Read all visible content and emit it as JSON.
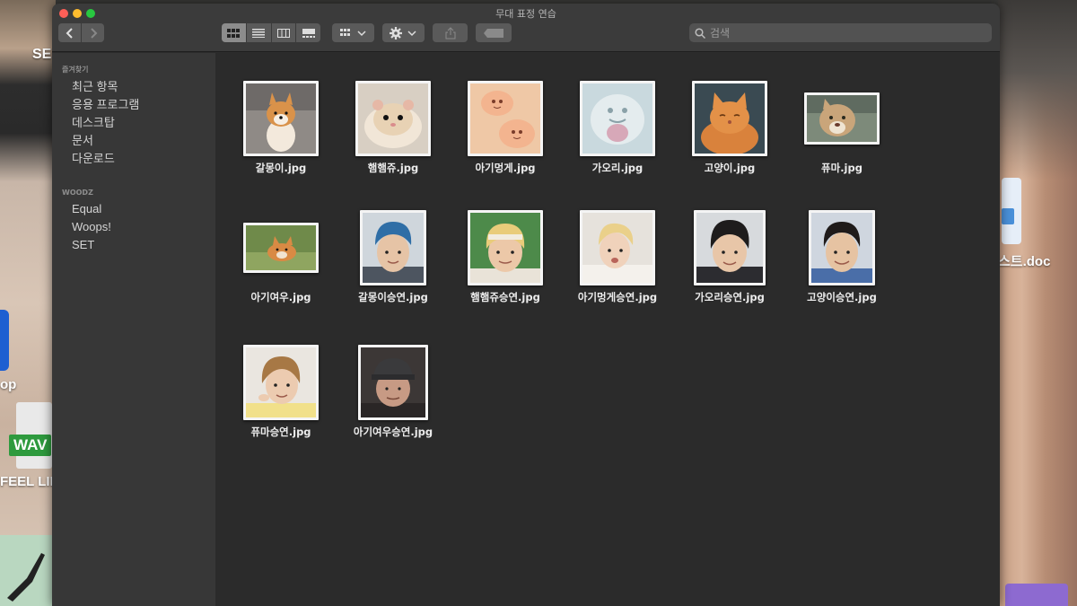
{
  "desktop": {
    "left_labels": [
      "SE",
      "op",
      "FEEL LIKI"
    ],
    "wav_tag": "WAV",
    "right_label": "스트.doc"
  },
  "window": {
    "title": "무대 표정 연습",
    "search": {
      "placeholder": "검색",
      "value": ""
    }
  },
  "sidebar": {
    "sections": [
      {
        "heading": "즐겨찾기",
        "items": [
          "최근 항목",
          "응용 프로그램",
          "데스크탑",
          "문서",
          "다운로드"
        ]
      },
      {
        "heading": "WOODZ",
        "items": [
          "Equal",
          "Woops!",
          "SET"
        ]
      }
    ]
  },
  "files": [
    {
      "name": "갈몽이.jpg",
      "subject": "shiba-dog"
    },
    {
      "name": "햄햄쥬.jpg",
      "subject": "hamster"
    },
    {
      "name": "아기멍게.jpg",
      "subject": "sea-squirt"
    },
    {
      "name": "가오리.jpg",
      "subject": "stingray"
    },
    {
      "name": "고양이.jpg",
      "subject": "orange-cat"
    },
    {
      "name": "퓨마.jpg",
      "subject": "puma"
    },
    {
      "name": "아기여우.jpg",
      "subject": "fox"
    },
    {
      "name": "갈몽이승연.jpg",
      "subject": "person-blue-hair"
    },
    {
      "name": "햄햄쥬승연.jpg",
      "subject": "person-blonde-headband"
    },
    {
      "name": "아기멍게승연.jpg",
      "subject": "person-blonde"
    },
    {
      "name": "가오리승연.jpg",
      "subject": "person-dark-hair"
    },
    {
      "name": "고양이승연.jpg",
      "subject": "person-dark-hair-2"
    },
    {
      "name": "퓨마승연.jpg",
      "subject": "person-brown-hair"
    },
    {
      "name": "아기여우승연.jpg",
      "subject": "person-cap"
    }
  ]
}
